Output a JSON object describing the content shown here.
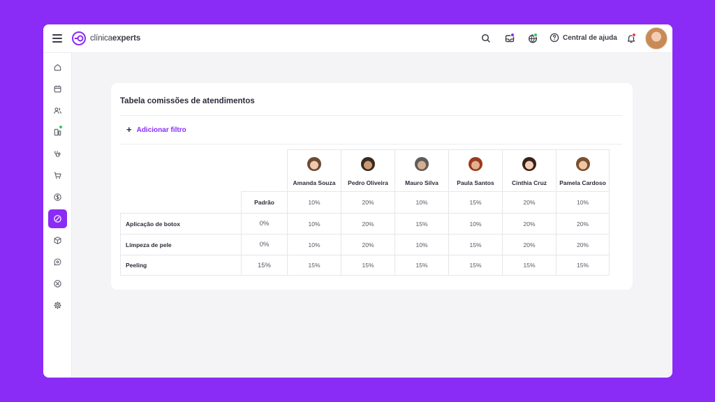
{
  "app": {
    "logo_light": "clínica",
    "logo_bold": "experts",
    "help_label": "Central de ajuda",
    "accent": "#8a2cf5"
  },
  "topbar_icons": [
    "search-icon",
    "inbox-icon",
    "globe-icon",
    "help-icon",
    "bell-icon"
  ],
  "sidebar": {
    "items": [
      {
        "icon": "home-icon"
      },
      {
        "icon": "calendar-icon"
      },
      {
        "icon": "users-icon"
      },
      {
        "icon": "device-icon"
      },
      {
        "icon": "stethoscope-icon"
      },
      {
        "icon": "cart-icon"
      },
      {
        "icon": "dollar-icon"
      },
      {
        "icon": "commission-icon",
        "active": true
      },
      {
        "icon": "box-icon"
      },
      {
        "icon": "chat-icon"
      },
      {
        "icon": "close-circle-icon"
      },
      {
        "icon": "gear-icon"
      }
    ]
  },
  "card": {
    "title": "Tabela comissões de atendimentos",
    "add_filter": "Adicionar filtro",
    "standard_label": "Padrão",
    "professionals": [
      {
        "name": "Amanda Souza",
        "skin": "#f0c9ad",
        "hair": "#6b4a35"
      },
      {
        "name": "Pedro Oliveira",
        "skin": "#c99a75",
        "hair": "#3a2a1e"
      },
      {
        "name": "Mauro Silva",
        "skin": "#d8ad8b",
        "hair": "#5d5d5d"
      },
      {
        "name": "Paula Santos",
        "skin": "#e2b08e",
        "hair": "#9b3a1f"
      },
      {
        "name": "Cinthia Cruz",
        "skin": "#f2cdb5",
        "hair": "#3b2218"
      },
      {
        "name": "Pamela Cardoso",
        "skin": "#efc5a6",
        "hair": "#7a4f2b"
      }
    ],
    "standard_values": [
      "10%",
      "20%",
      "10%",
      "15%",
      "20%",
      "10%"
    ],
    "rows": [
      {
        "label": "Aplicação de botox",
        "standard": "0%",
        "values": [
          "10%",
          "20%",
          "15%",
          "10%",
          "20%",
          "20%"
        ]
      },
      {
        "label": "Limpeza de pele",
        "standard": "0%",
        "values": [
          "10%",
          "20%",
          "10%",
          "15%",
          "20%",
          "20%"
        ]
      },
      {
        "label": "Peeling",
        "standard": "15%",
        "values": [
          "15%",
          "15%",
          "15%",
          "15%",
          "15%",
          "15%"
        ]
      }
    ]
  }
}
